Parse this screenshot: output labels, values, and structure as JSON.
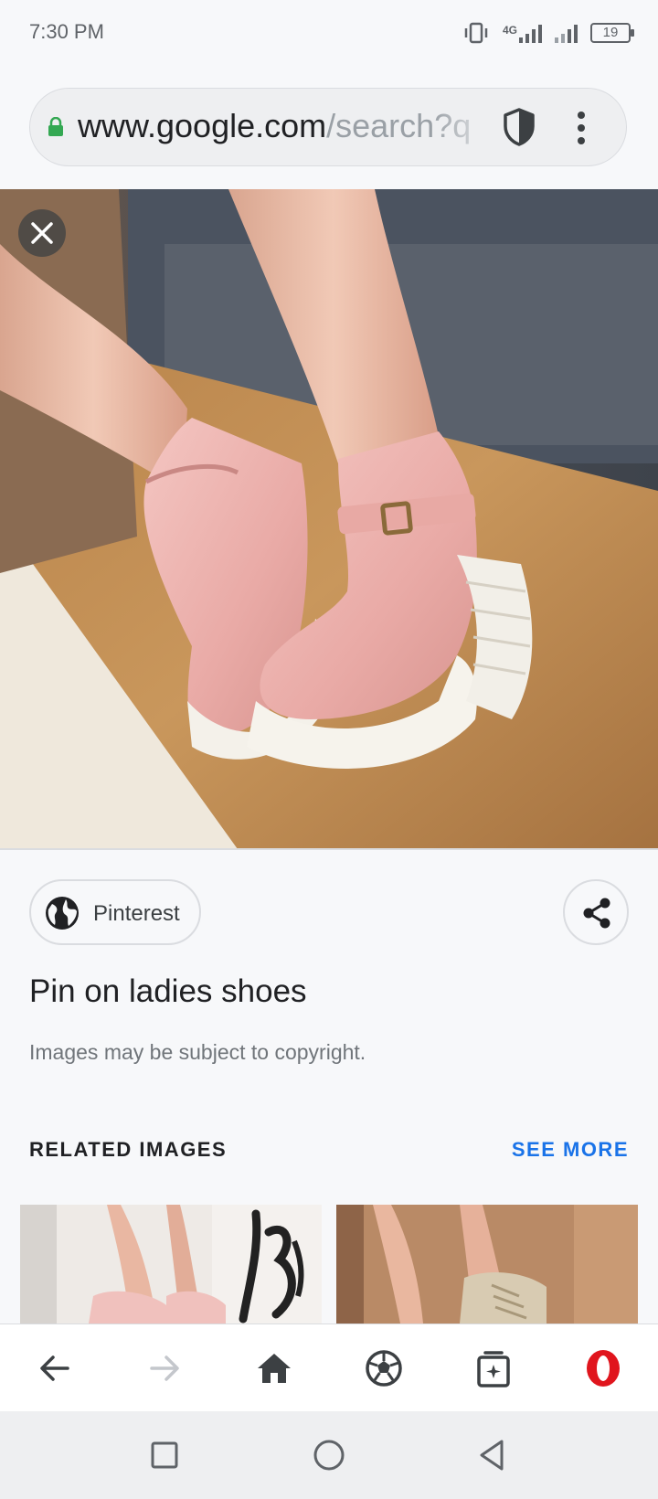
{
  "status_bar": {
    "time": "7:30 PM",
    "network": "4G",
    "battery": "19"
  },
  "address_bar": {
    "domain": "www.google.com",
    "path": "/search?q"
  },
  "image_viewer": {
    "source": "Pinterest",
    "title": "Pin on ladies shoes",
    "copyright_note": "Images may be subject to copyright."
  },
  "related": {
    "heading": "RELATED IMAGES",
    "see_more": "SEE MORE"
  },
  "colors": {
    "accent_blue": "#1a73e8",
    "opera_red": "#e0151d",
    "lock_green": "#34a853"
  },
  "icons": {
    "lock": "lock-icon",
    "shield": "shield-icon",
    "menu": "more-vert-icon",
    "close": "close-icon",
    "globe": "globe-icon",
    "share": "share-icon",
    "back": "arrow-left-icon",
    "forward": "arrow-right-icon",
    "home": "home-icon",
    "speed_dial": "soccer-ball-icon",
    "tabs": "tabs-icon",
    "opera": "opera-logo-icon"
  }
}
